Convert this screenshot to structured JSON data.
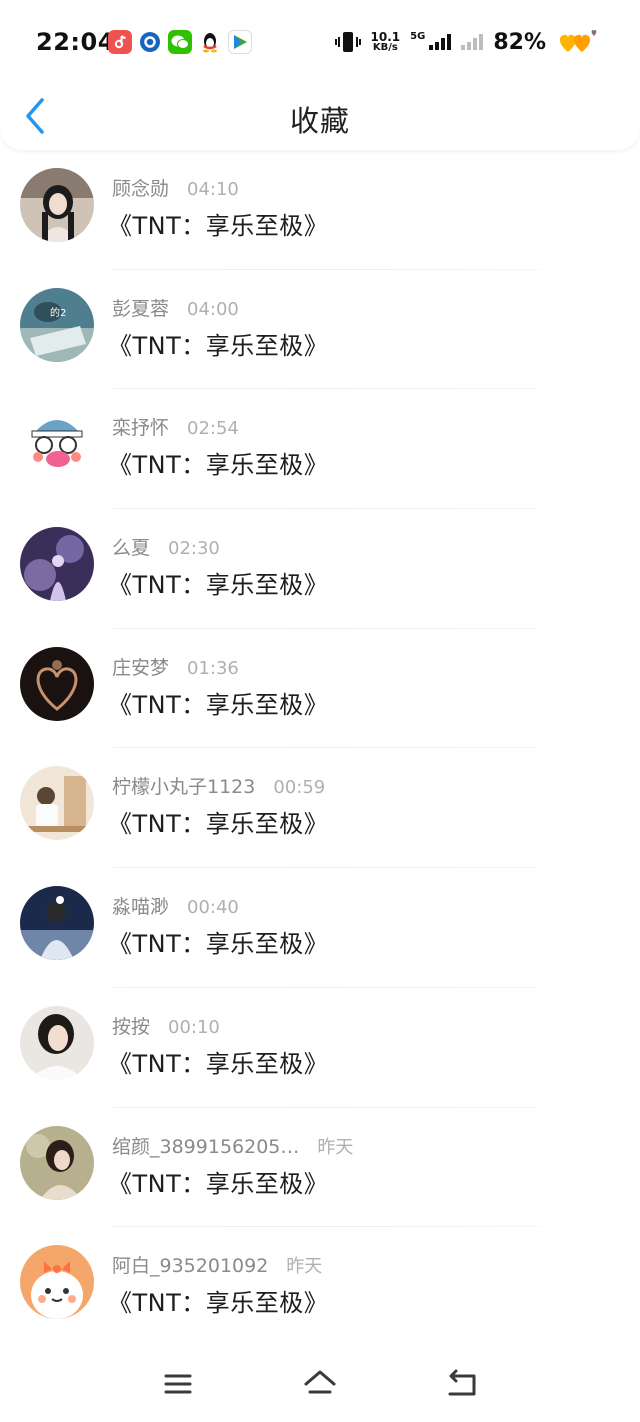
{
  "status_bar": {
    "time": "22:04",
    "net_speed_value": "10.1",
    "net_speed_unit": "KB/s",
    "network_type": "5G",
    "battery": "82%",
    "app_icons": [
      "douyin-icon",
      "blue-circle-app-icon",
      "wechat-icon",
      "qq-icon",
      "video-app-icon"
    ]
  },
  "header": {
    "title": "收藏",
    "back_icon": "chevron-left-icon",
    "accent_color": "#2196f3"
  },
  "favorites": [
    {
      "name": "顾念勋",
      "time": "04:10",
      "content": "《TNT：享乐至极》"
    },
    {
      "name": "彭夏蓉",
      "time": "04:00",
      "content": "《TNT：享乐至极》"
    },
    {
      "name": "栾抒怀",
      "time": "02:54",
      "content": "《TNT：享乐至极》"
    },
    {
      "name": "么夏",
      "time": "02:30",
      "content": "《TNT：享乐至极》"
    },
    {
      "name": "庄安梦",
      "time": "01:36",
      "content": "《TNT：享乐至极》"
    },
    {
      "name": "柠檬小丸子1123",
      "time": "00:59",
      "content": "《TNT：享乐至极》"
    },
    {
      "name": "淼喵渺",
      "time": "00:40",
      "content": "《TNT：享乐至极》"
    },
    {
      "name": "按按",
      "time": "00:10",
      "content": "《TNT：享乐至极》"
    },
    {
      "name": "绾颜_3899156205…",
      "time": "昨天",
      "content": "《TNT：享乐至极》"
    },
    {
      "name": "阿白_935201092",
      "time": "昨天",
      "content": "《TNT：享乐至极》"
    }
  ],
  "nav_bar": {
    "icons": [
      "menu-icon",
      "home-icon",
      "back-icon"
    ]
  }
}
